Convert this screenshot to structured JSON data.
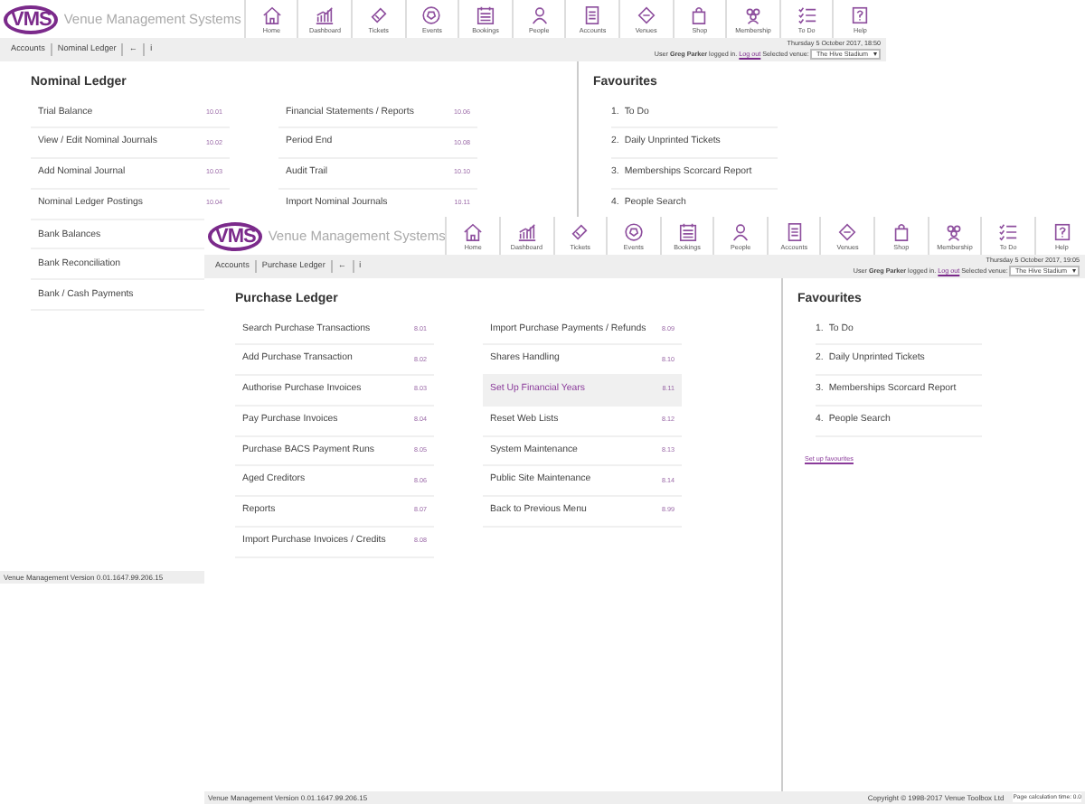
{
  "windows": [
    {
      "logo": "VMS",
      "app_name": "Venue Management Systems",
      "nav": [
        {
          "label": "Home"
        },
        {
          "label": "Dashboard"
        },
        {
          "label": "Tickets"
        },
        {
          "label": "Events"
        },
        {
          "label": "Bookings"
        },
        {
          "label": "People"
        },
        {
          "label": "Accounts"
        },
        {
          "label": "Venues"
        },
        {
          "label": "Shop"
        },
        {
          "label": "Membership"
        },
        {
          "label": "To Do"
        },
        {
          "label": "Help"
        }
      ],
      "breadcrumb": [
        "Accounts",
        "Nominal Ledger"
      ],
      "back": "←",
      "info": "ℹ",
      "date": "Thursday 5 October 2017, 18:50",
      "user_text": "User **Greg Parker** logged in.",
      "logout": "Log out",
      "venue_label": "Selected venue:",
      "venue": "The Hive Stadium",
      "menu": {
        "title": "Nominal Ledger",
        "columns": [
          [
            {
              "label": "Trial Balance",
              "code": "10.01",
              "selected": false
            },
            {
              "label": "View / Edit Nominal Journals",
              "code": "10.02",
              "selected": false
            },
            {
              "label": "Add Nominal Journal",
              "code": "10.03",
              "selected": false
            },
            {
              "label": "Nominal Ledger Postings",
              "code": "10.04",
              "selected": false
            },
            {
              "label": "Bank Balances",
              "selected": false
            },
            {
              "label": "Bank Reconciliation",
              "selected": false
            },
            {
              "label": "Bank / Cash Payments",
              "selected": false
            }
          ],
          [
            {
              "label": "Financial Statements / Reports",
              "code": "10.06",
              "selected": false
            },
            {
              "label": "Period End",
              "code": "10.08",
              "selected": false
            },
            {
              "label": "Audit Trail",
              "code": "10.10",
              "selected": false
            },
            {
              "label": "Import Nominal Journals",
              "code": "10.11",
              "selected": false
            }
          ]
        ]
      },
      "favourites": {
        "title": "Favourites",
        "items": [
          {
            "number": "1.",
            "label": "To Do"
          },
          {
            "number": "2.",
            "label": "Daily Unprinted Tickets"
          },
          {
            "number": "3.",
            "label": "Memberships Scorcard Report"
          },
          {
            "number": "4.",
            "label": "People Search"
          }
        ]
      },
      "footer": {
        "version": "Venue Management Version 0.01.1647.99.206.15"
      }
    },
    {
      "logo": "VMS",
      "app_name": "Venue Management Systems",
      "nav": [
        {
          "label": "Home"
        },
        {
          "label": "Dashboard"
        },
        {
          "label": "Tickets"
        },
        {
          "label": "Events"
        },
        {
          "label": "Bookings"
        },
        {
          "label": "People"
        },
        {
          "label": "Accounts"
        },
        {
          "label": "Venues"
        },
        {
          "label": "Shop"
        },
        {
          "label": "Membership"
        },
        {
          "label": "To Do"
        },
        {
          "label": "Help"
        }
      ],
      "breadcrumb": [
        "Accounts",
        "Purchase Ledger"
      ],
      "back": "←",
      "info": "ℹ",
      "date": "Thursday 5 October 2017, 19:05",
      "user_text": "User **Greg Parker** logged in.",
      "logout": "Log out",
      "venue_label": "Selected venue:",
      "venue": "The Hive Stadium",
      "menu": {
        "title": "Purchase Ledger",
        "columns": [
          [
            {
              "label": "Search Purchase Transactions",
              "code": "8.01",
              "selected": false
            },
            {
              "label": "Add Purchase Transaction",
              "code": "8.02",
              "selected": false
            },
            {
              "label": "Authorise Purchase Invoices",
              "code": "8.03",
              "selected": false
            },
            {
              "label": "Pay Purchase Invoices",
              "code": "8.04",
              "selected": false
            },
            {
              "label": "Purchase BACS Payment Runs",
              "code": "8.05",
              "selected": false
            },
            {
              "label": "Aged Creditors",
              "code": "8.06",
              "selected": false
            },
            {
              "label": "Reports",
              "code": "8.07",
              "selected": false
            },
            {
              "label": "Import Purchase Invoices / Credits",
              "code": "8.08",
              "selected": false
            }
          ],
          [
            {
              "label": "Import Purchase Payments / Refunds",
              "code": "8.09",
              "selected": false
            },
            {
              "label": "Shares Handling",
              "code": "8.10",
              "selected": false
            },
            {
              "label": "Set Up Financial Years",
              "code": "8.11",
              "selected": true
            },
            {
              "label": "Reset Web Lists",
              "code": "8.12",
              "selected": false
            },
            {
              "label": "System Maintenance",
              "code": "8.13",
              "selected": false
            },
            {
              "label": "Public Site Maintenance",
              "code": "8.14",
              "selected": false
            },
            {
              "label": "Back to Previous Menu",
              "code": "8.99",
              "selected": false
            }
          ]
        ]
      },
      "favourites": {
        "title": "Favourites",
        "items": [
          {
            "number": "1.",
            "label": "To Do"
          },
          {
            "number": "2.",
            "label": "Daily Unprinted Tickets"
          },
          {
            "number": "3.",
            "label": "Memberships Scorcard Report"
          },
          {
            "number": "4.",
            "label": "People Search"
          }
        ],
        "setup_link": "Set up favourites"
      },
      "footer": {
        "version": "Venue Management Version 0.01.1647.99.206.15",
        "copyright": "Copyright © 1998-2017 Venue Toolbox Ltd",
        "calc": "Page calculation time: 0.0"
      }
    }
  ]
}
